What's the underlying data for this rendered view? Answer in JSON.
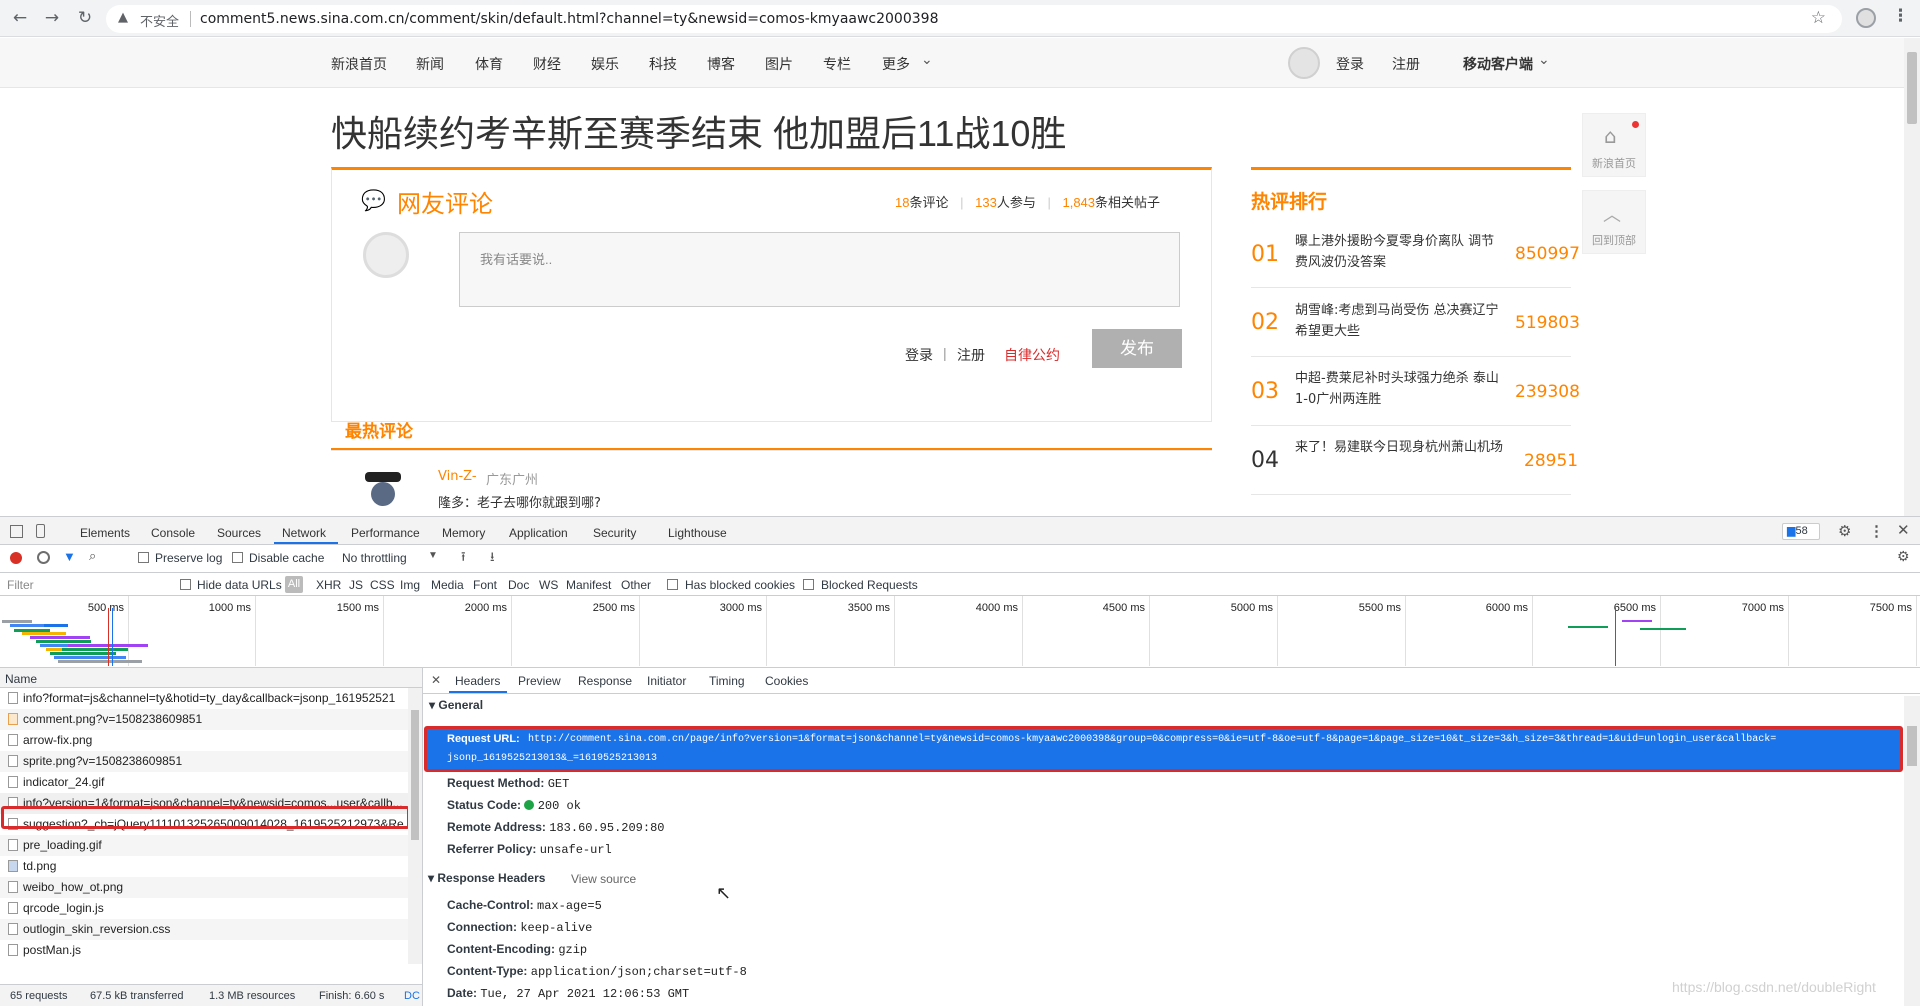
{
  "browser": {
    "insecure_label": "不安全",
    "url": "comment5.news.sina.com.cn/comment/skin/default.html?channel=ty&newsid=comos-kmyaawc2000398"
  },
  "nav": {
    "items": [
      "新浪首页",
      "新闻",
      "体育",
      "财经",
      "娱乐",
      "科技",
      "博客",
      "图片",
      "专栏",
      "更多"
    ],
    "login": "登录",
    "register": "注册",
    "mobile": "移动客户端"
  },
  "article": {
    "title": "快船续约考辛斯至赛季结束 他加盟后11战10胜"
  },
  "comments": {
    "heading": "网友评论",
    "comment_count": "18",
    "comment_count_suffix": "条评论",
    "participants": "133",
    "participants_suffix": "人参与",
    "related_posts": "1,843",
    "related_posts_suffix": "条相关帖子",
    "input_placeholder": "我有话要说..",
    "login": "登录",
    "register": "注册",
    "rules": "自律公约",
    "publish": "发布",
    "hot_heading": "最热评论",
    "first_comment_user": "Vin-Z-",
    "first_comment_location": "广东广州",
    "first_comment_text": "隆多：老子去哪你就跟到哪?"
  },
  "hot_ranking": {
    "heading": "热评排行",
    "items": [
      {
        "rank": "01",
        "text": "曝上港外援盼今夏零身价离队 调节费风波仍没答案",
        "count": "850997"
      },
      {
        "rank": "02",
        "text": "胡雪峰:考虑到马尚受伤 总决赛辽宁希望更大些",
        "count": "519803"
      },
      {
        "rank": "03",
        "text": "中超-费莱尼补时头球强力绝杀 泰山1-0广州两连胜",
        "count": "239308"
      },
      {
        "rank": "04",
        "text": "来了！易建联今日现身杭州萧山机场",
        "count": "28951"
      }
    ]
  },
  "side_buttons": {
    "home": "新浪首页",
    "top": "回到顶部"
  },
  "devtools": {
    "tabs": [
      "Elements",
      "Console",
      "Sources",
      "Network",
      "Performance",
      "Memory",
      "Application",
      "Security",
      "Lighthouse"
    ],
    "active_tab": "Network",
    "message_count": "58",
    "preserve_log": "Preserve log",
    "disable_cache": "Disable cache",
    "throttling": "No throttling",
    "filter_placeholder": "Filter",
    "hide_data_urls": "Hide data URLs",
    "type_filters": [
      "All",
      "XHR",
      "JS",
      "CSS",
      "Img",
      "Media",
      "Font",
      "Doc",
      "WS",
      "Manifest",
      "Other"
    ],
    "has_blocked_cookies": "Has blocked cookies",
    "blocked_requests": "Blocked Requests",
    "timeline_ticks": [
      "500 ms",
      "1000 ms",
      "1500 ms",
      "2000 ms",
      "2500 ms",
      "3000 ms",
      "3500 ms",
      "4000 ms",
      "4500 ms",
      "5000 ms",
      "5500 ms",
      "6000 ms",
      "6500 ms",
      "7000 ms",
      "7500 ms"
    ],
    "name_header": "Name",
    "requests": [
      "info?format=js&channel=ty&hotid=ty_day&callback=jsonp_161952521",
      "comment.png?v=1508238609851",
      "arrow-fix.png",
      "sprite.png?v=1508238609851",
      "indicator_24.gif",
      "info?version=1&format=json&channel=ty&newsid=comos...user&callb...",
      "suggestion?_cb=jQuery111101325265009014028_1619525212973&Re",
      "pre_loading.gif",
      "td.png",
      "weibo_how_ot.png",
      "qrcode_login.js",
      "outlogin_skin_reversion.css",
      "postMan.js"
    ],
    "selected_request_index": 5,
    "detail_tabs": [
      "Headers",
      "Preview",
      "Response",
      "Initiator",
      "Timing",
      "Cookies"
    ],
    "general_label": "General",
    "request_url_key": "Request URL:",
    "request_url_value": "http://comment.sina.com.cn/page/info?version=1&format=json&channel=ty&newsid=comos-kmyaawc2000398&group=0&compress=0&ie=utf-8&oe=utf-8&page=1&page_size=10&t_size=3&h_size=3&thread=1&uid=unlogin_user&callback=jsonp_1619525213013&_=1619525213013",
    "request_url_line1": "http://comment.sina.com.cn/page/info?version=1&format=json&channel=ty&newsid=comos-kmyaawc2000398&group=0&compress=0&ie=utf-8&oe=utf-8&page=1&page_size=10&t_size=3&h_size=3&thread=1&uid=unlogin_user&callback=",
    "request_url_line2": "jsonp_1619525213013&_=1619525213013",
    "general": [
      {
        "key": "Request Method:",
        "value": "GET"
      },
      {
        "key": "Status Code:",
        "value": "200 ok"
      },
      {
        "key": "Remote Address:",
        "value": "183.60.95.209:80"
      },
      {
        "key": "Referrer Policy:",
        "value": "unsafe-url"
      }
    ],
    "response_headers_label": "Response Headers",
    "view_source": "View source",
    "response_headers": [
      {
        "key": "Cache-Control:",
        "value": "max-age=5"
      },
      {
        "key": "Connection:",
        "value": "keep-alive"
      },
      {
        "key": "Content-Encoding:",
        "value": "gzip"
      },
      {
        "key": "Content-Type:",
        "value": "application/json;charset=utf-8"
      },
      {
        "key": "Date:",
        "value": "Tue, 27 Apr 2021 12:06:53 GMT"
      }
    ],
    "status_bar": [
      "65 requests",
      "67.5 kB transferred",
      "1.3 MB resources",
      "Finish: 6.60 s",
      "DC"
    ],
    "watermark": "https://blog.csdn.net/doubleRight"
  },
  "colors": {
    "accent_orange": "#ff8400",
    "highlight_red": "#d92b2b",
    "selection_blue": "#1a73e8"
  }
}
